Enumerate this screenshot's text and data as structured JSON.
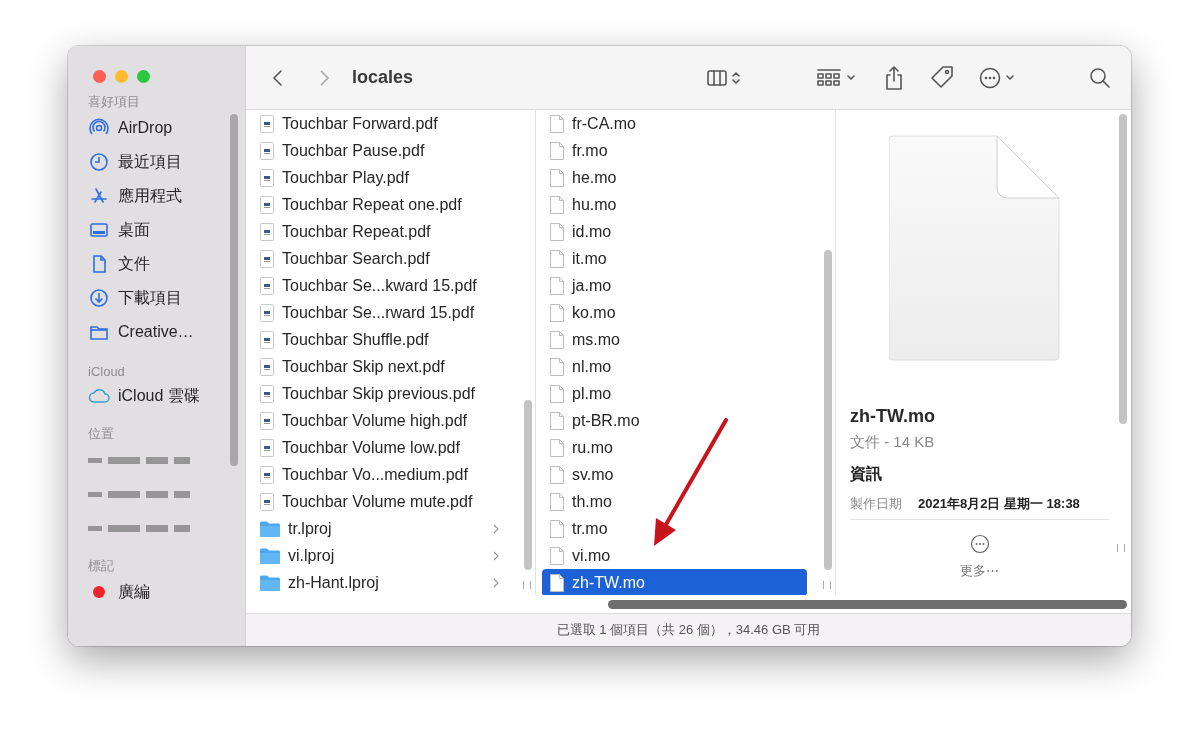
{
  "window": {
    "title": "locales"
  },
  "sidebar": {
    "sections": [
      {
        "heading": "喜好項目",
        "items": [
          {
            "label": "AirDrop",
            "kind": "airdrop"
          },
          {
            "label": "最近項目",
            "kind": "clock"
          },
          {
            "label": "應用程式",
            "kind": "apps"
          },
          {
            "label": "桌面",
            "kind": "desktop"
          },
          {
            "label": "文件",
            "kind": "document"
          },
          {
            "label": "下載項目",
            "kind": "download"
          },
          {
            "label": "Creative…",
            "kind": "folder"
          }
        ]
      },
      {
        "heading": "iCloud",
        "items": [
          {
            "label": "iCloud 雲碟",
            "kind": "cloud"
          }
        ]
      },
      {
        "heading": "位置",
        "items": [
          {
            "kind": "redacted"
          },
          {
            "kind": "redacted"
          },
          {
            "kind": "redacted"
          }
        ]
      },
      {
        "heading": "標記",
        "items": [
          {
            "label": "廣編",
            "kind": "tag",
            "color": "#f0242b"
          }
        ]
      }
    ]
  },
  "columns": [
    {
      "items": [
        {
          "name": "Touchbar Forward.pdf",
          "kind": "pdf",
          "selected": false
        },
        {
          "name": "Touchbar Pause.pdf",
          "kind": "pdf",
          "selected": false
        },
        {
          "name": "Touchbar Play.pdf",
          "kind": "pdf",
          "selected": false
        },
        {
          "name": "Touchbar Repeat one.pdf",
          "kind": "pdf",
          "selected": false
        },
        {
          "name": "Touchbar Repeat.pdf",
          "kind": "pdf",
          "selected": false
        },
        {
          "name": "Touchbar Search.pdf",
          "kind": "pdf",
          "selected": false
        },
        {
          "name": "Touchbar Se...kward 15.pdf",
          "kind": "pdf",
          "selected": false
        },
        {
          "name": "Touchbar Se...rward 15.pdf",
          "kind": "pdf",
          "selected": false
        },
        {
          "name": "Touchbar Shuffle.pdf",
          "kind": "pdf",
          "selected": false
        },
        {
          "name": "Touchbar Skip next.pdf",
          "kind": "pdf",
          "selected": false
        },
        {
          "name": "Touchbar Skip previous.pdf",
          "kind": "pdf",
          "selected": false
        },
        {
          "name": "Touchbar Volume high.pdf",
          "kind": "pdf",
          "selected": false
        },
        {
          "name": "Touchbar Volume low.pdf",
          "kind": "pdf",
          "selected": false
        },
        {
          "name": "Touchbar Vo...medium.pdf",
          "kind": "pdf",
          "selected": false
        },
        {
          "name": "Touchbar Volume mute.pdf",
          "kind": "pdf",
          "selected": false
        },
        {
          "name": "tr.lproj",
          "kind": "folder",
          "selected": false
        },
        {
          "name": "vi.lproj",
          "kind": "folder",
          "selected": false
        },
        {
          "name": "zh-Hant.lproj",
          "kind": "folder",
          "selected": false
        }
      ]
    },
    {
      "items": [
        {
          "name": "fr-CA.mo",
          "kind": "file",
          "selected": false
        },
        {
          "name": "fr.mo",
          "kind": "file",
          "selected": false
        },
        {
          "name": "he.mo",
          "kind": "file",
          "selected": false
        },
        {
          "name": "hu.mo",
          "kind": "file",
          "selected": false
        },
        {
          "name": "id.mo",
          "kind": "file",
          "selected": false
        },
        {
          "name": "it.mo",
          "kind": "file",
          "selected": false
        },
        {
          "name": "ja.mo",
          "kind": "file",
          "selected": false
        },
        {
          "name": "ko.mo",
          "kind": "file",
          "selected": false
        },
        {
          "name": "ms.mo",
          "kind": "file",
          "selected": false
        },
        {
          "name": "nl.mo",
          "kind": "file",
          "selected": false
        },
        {
          "name": "pl.mo",
          "kind": "file",
          "selected": false
        },
        {
          "name": "pt-BR.mo",
          "kind": "file",
          "selected": false
        },
        {
          "name": "ru.mo",
          "kind": "file",
          "selected": false
        },
        {
          "name": "sv.mo",
          "kind": "file",
          "selected": false
        },
        {
          "name": "th.mo",
          "kind": "file",
          "selected": false
        },
        {
          "name": "tr.mo",
          "kind": "file",
          "selected": false
        },
        {
          "name": "vi.mo",
          "kind": "file",
          "selected": false
        },
        {
          "name": "zh-TW.mo",
          "kind": "file",
          "selected": true
        }
      ]
    }
  ],
  "preview": {
    "name": "zh-TW.mo",
    "subtitle": "文件 - 14 KB",
    "info_heading": "資訊",
    "info": [
      {
        "label": "製作日期",
        "value": "2021年8月2日 星期一 18:38"
      }
    ],
    "more": "更多⋯"
  },
  "status_bar": "已選取 1 個項目（共 26 個），34.46 GB 可用"
}
